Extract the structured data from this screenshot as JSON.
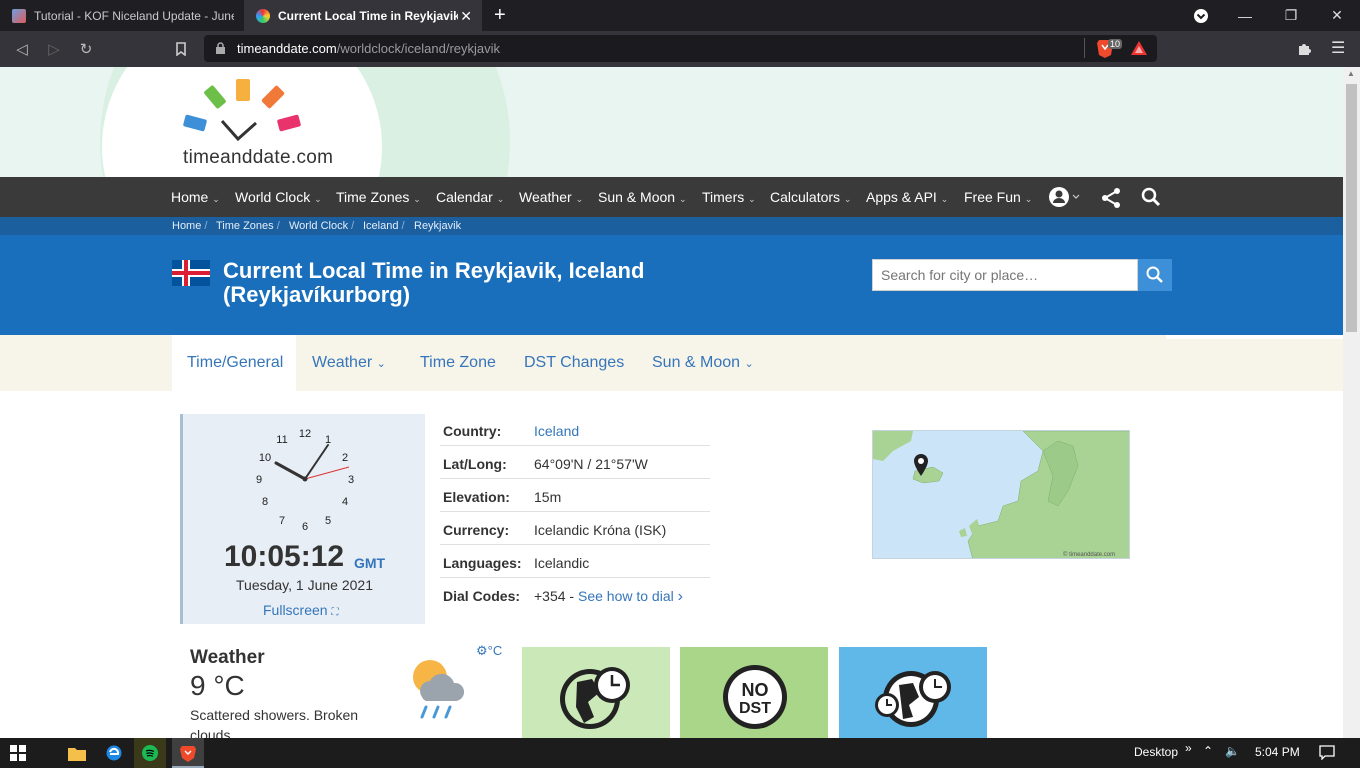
{
  "browser": {
    "tabs": [
      {
        "title": "Tutorial - KOF Niceland Update - June",
        "active": false
      },
      {
        "title": "Current Local Time in Reykjavik, Ic",
        "active": true
      }
    ],
    "url_domain": "timeanddate.com",
    "url_path": "/worldclock/iceland/reykjavik",
    "shield_count": "10"
  },
  "site": {
    "logo_text": "timeanddate.com",
    "nav": [
      "Home",
      "World Clock",
      "Time Zones",
      "Calendar",
      "Weather",
      "Sun & Moon",
      "Timers",
      "Calculators",
      "Apps & API",
      "Free Fun"
    ],
    "breadcrumbs": [
      "Home",
      "Time Zones",
      "World Clock",
      "Iceland",
      "Reykjavik"
    ],
    "page_title": "Current Local Time in Reykjavik, Iceland (Reykjavíkurborg)",
    "search_placeholder": "Search for city or place…",
    "subtabs": [
      "Time/General",
      "Weather",
      "Time Zone",
      "DST Changes",
      "Sun & Moon"
    ]
  },
  "clock": {
    "time": "10:05:12",
    "zone": "GMT",
    "date": "Tuesday, 1 June 2021",
    "fullscreen_label": "Fullscreen",
    "numerals": [
      "12",
      "1",
      "2",
      "3",
      "4",
      "5",
      "6",
      "7",
      "8",
      "9",
      "10",
      "11"
    ]
  },
  "info": [
    {
      "label": "Country:",
      "value": "Iceland",
      "link": true
    },
    {
      "label": "Lat/Long:",
      "value": "64°09'N / 21°57'W",
      "link": false
    },
    {
      "label": "Elevation:",
      "value": "15m",
      "link": false
    },
    {
      "label": "Currency:",
      "value": "Icelandic Króna (ISK)",
      "link": false
    },
    {
      "label": "Languages:",
      "value": "Icelandic",
      "link": false
    },
    {
      "label": "Dial Codes:",
      "value": "+354 - ",
      "link_text": "See how to dial"
    }
  ],
  "map_credit": "© timeanddate.com",
  "weather": {
    "title": "Weather",
    "temp": "9 °C",
    "description": "Scattered showers. Broken clouds.",
    "unit_toggle": "°C"
  },
  "tiles": {
    "nodst_line1": "NO",
    "nodst_line2": "DST"
  },
  "taskbar": {
    "desktop_label": "Desktop",
    "time": "5:04 PM"
  },
  "colors": {
    "banner": "#1a6fbd",
    "nav": "#3a3a3a",
    "link": "#3576ba"
  }
}
